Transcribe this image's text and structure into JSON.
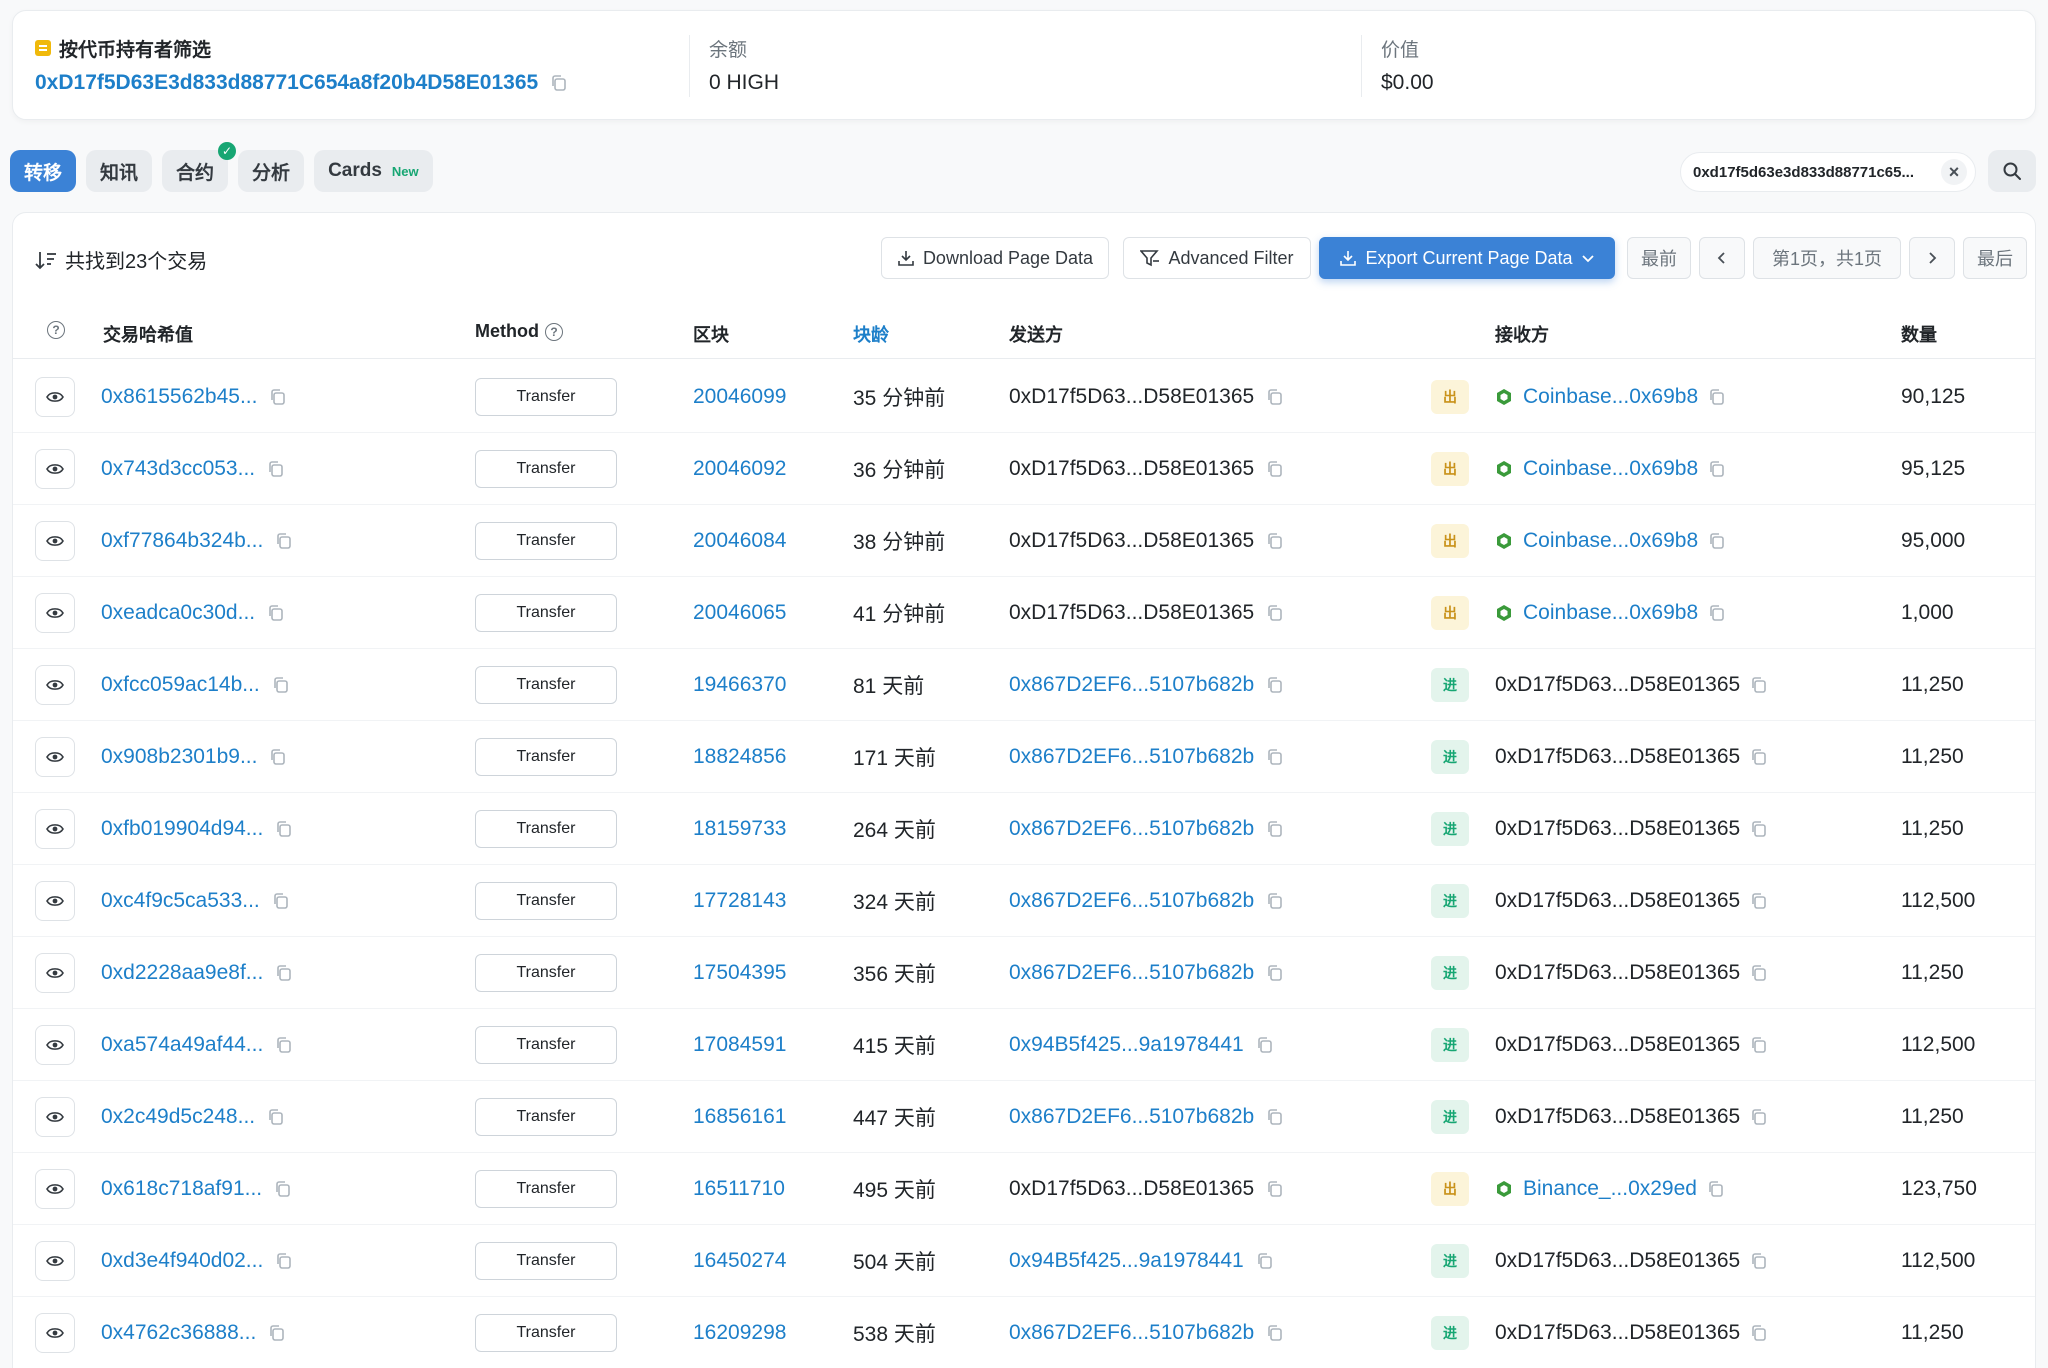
{
  "header": {
    "filter_label": "按代币持有者筛选",
    "filter_address": "0xD17f5D63E3d833d88771C654a8f20b4D58E01365",
    "balance_label": "余额",
    "balance_value": "0 HIGH",
    "value_label": "价值",
    "value_value": "$0.00"
  },
  "tabs": [
    {
      "label": "转移"
    },
    {
      "label": "知讯"
    },
    {
      "label": "合约"
    },
    {
      "label": "分析"
    },
    {
      "label": "Cards",
      "badge": "New"
    }
  ],
  "filter_chip": "0xd17f5d63e3d833d88771c65...",
  "toolbar": {
    "found_text": "共找到23个交易",
    "download": "Download Page Data",
    "advanced": "Advanced Filter",
    "export": "Export Current Page Data",
    "first": "最前",
    "page_info": "第1页，共1页",
    "last": "最后"
  },
  "columns": {
    "hash": "交易哈希值",
    "method": "Method",
    "block": "区块",
    "age": "块龄",
    "from": "发送方",
    "to": "接收方",
    "amount": "数量"
  },
  "rows": [
    {
      "hash": "0x8615562b45...",
      "method": "Transfer",
      "block": "20046099",
      "age": "35 分钟前",
      "from": "0xD17f5D63...D58E01365",
      "dir": "出",
      "to": "Coinbase...0x69b8",
      "amount": "90,125"
    },
    {
      "hash": "0x743d3cc053...",
      "method": "Transfer",
      "block": "20046092",
      "age": "36 分钟前",
      "from": "0xD17f5D63...D58E01365",
      "dir": "出",
      "to": "Coinbase...0x69b8",
      "amount": "95,125"
    },
    {
      "hash": "0xf77864b324b...",
      "method": "Transfer",
      "block": "20046084",
      "age": "38 分钟前",
      "from": "0xD17f5D63...D58E01365",
      "dir": "出",
      "to": "Coinbase...0x69b8",
      "amount": "95,000"
    },
    {
      "hash": "0xeadca0c30d...",
      "method": "Transfer",
      "block": "20046065",
      "age": "41 分钟前",
      "from": "0xD17f5D63...D58E01365",
      "dir": "出",
      "to": "Coinbase...0x69b8",
      "amount": "1,000"
    },
    {
      "hash": "0xfcc059ac14b...",
      "method": "Transfer",
      "block": "19466370",
      "age": "81 天前",
      "from": "0x867D2EF6...5107b682b",
      "dir": "进",
      "to": "0xD17f5D63...D58E01365",
      "amount": "11,250"
    },
    {
      "hash": "0x908b2301b9...",
      "method": "Transfer",
      "block": "18824856",
      "age": "171 天前",
      "from": "0x867D2EF6...5107b682b",
      "dir": "进",
      "to": "0xD17f5D63...D58E01365",
      "amount": "11,250"
    },
    {
      "hash": "0xfb019904d94...",
      "method": "Transfer",
      "block": "18159733",
      "age": "264 天前",
      "from": "0x867D2EF6...5107b682b",
      "dir": "进",
      "to": "0xD17f5D63...D58E01365",
      "amount": "11,250"
    },
    {
      "hash": "0xc4f9c5ca533...",
      "method": "Transfer",
      "block": "17728143",
      "age": "324 天前",
      "from": "0x867D2EF6...5107b682b",
      "dir": "进",
      "to": "0xD17f5D63...D58E01365",
      "amount": "112,500"
    },
    {
      "hash": "0xd2228aa9e8f...",
      "method": "Transfer",
      "block": "17504395",
      "age": "356 天前",
      "from": "0x867D2EF6...5107b682b",
      "dir": "进",
      "to": "0xD17f5D63...D58E01365",
      "amount": "11,250"
    },
    {
      "hash": "0xa574a49af44...",
      "method": "Transfer",
      "block": "17084591",
      "age": "415 天前",
      "from": "0x94B5f425...9a1978441",
      "dir": "进",
      "to": "0xD17f5D63...D58E01365",
      "amount": "112,500"
    },
    {
      "hash": "0x2c49d5c248...",
      "method": "Transfer",
      "block": "16856161",
      "age": "447 天前",
      "from": "0x867D2EF6...5107b682b",
      "dir": "进",
      "to": "0xD17f5D63...D58E01365",
      "amount": "11,250"
    },
    {
      "hash": "0x618c718af91...",
      "method": "Transfer",
      "block": "16511710",
      "age": "495 天前",
      "from": "0xD17f5D63...D58E01365",
      "dir": "出",
      "to": "Binance_...0x29ed",
      "amount": "123,750"
    },
    {
      "hash": "0xd3e4f940d02...",
      "method": "Transfer",
      "block": "16450274",
      "age": "504 天前",
      "from": "0x94B5f425...9a1978441",
      "dir": "进",
      "to": "0xD17f5D63...D58E01365",
      "amount": "112,500"
    },
    {
      "hash": "0x4762c36888...",
      "method": "Transfer",
      "block": "16209298",
      "age": "538 天前",
      "from": "0x867D2EF6...5107b682b",
      "dir": "进",
      "to": "0xD17f5D63...D58E01365",
      "amount": "11,250"
    }
  ],
  "colors": {
    "link": "#1d7fc9",
    "primary": "#3b82d6",
    "out_badge": "#c9921a",
    "in_badge": "#17a673",
    "exchange_icon": "#3a9a3a"
  }
}
